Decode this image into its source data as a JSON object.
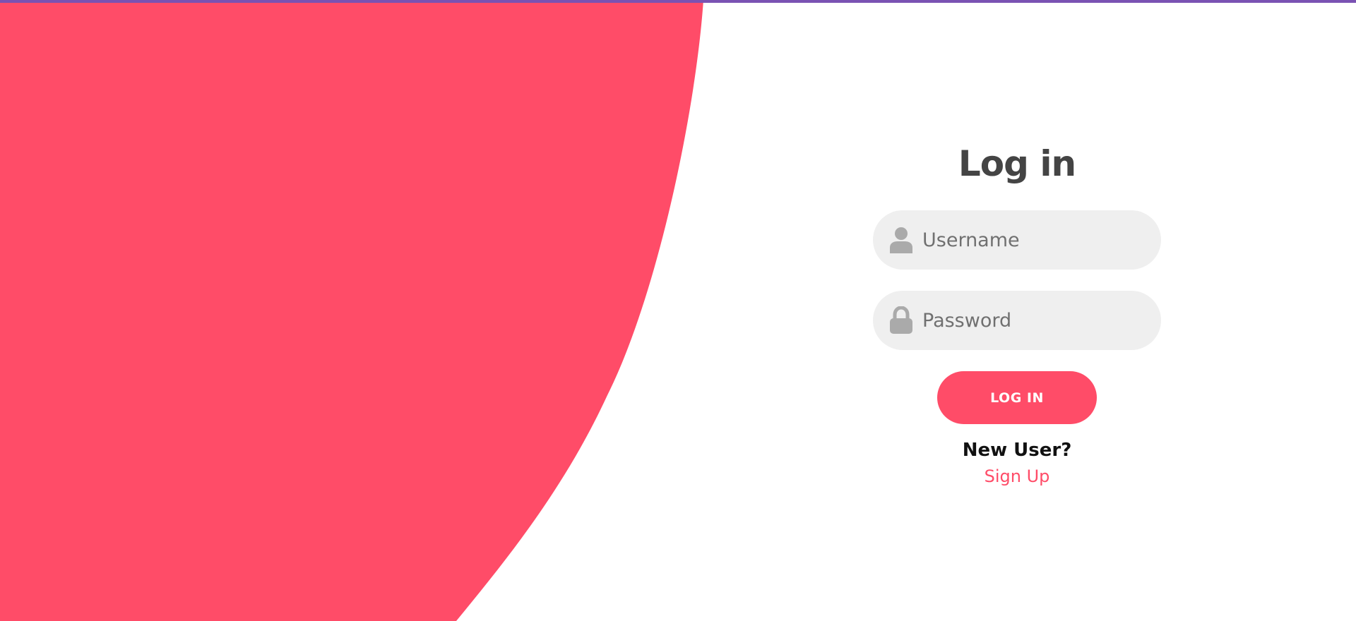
{
  "colors": {
    "accent": "#ff4c68",
    "top_border": "#7a52b3",
    "title": "#444444",
    "field_bg": "#efefef",
    "icon": "#aaaaaa"
  },
  "login_form": {
    "title": "Log in",
    "username": {
      "icon": "user-icon",
      "placeholder": "Username",
      "value": ""
    },
    "password": {
      "icon": "lock-icon",
      "placeholder": "Password",
      "value": ""
    },
    "submit_label": "LOG IN",
    "new_user_prompt": "New User?",
    "signup_link_label": "Sign Up"
  }
}
